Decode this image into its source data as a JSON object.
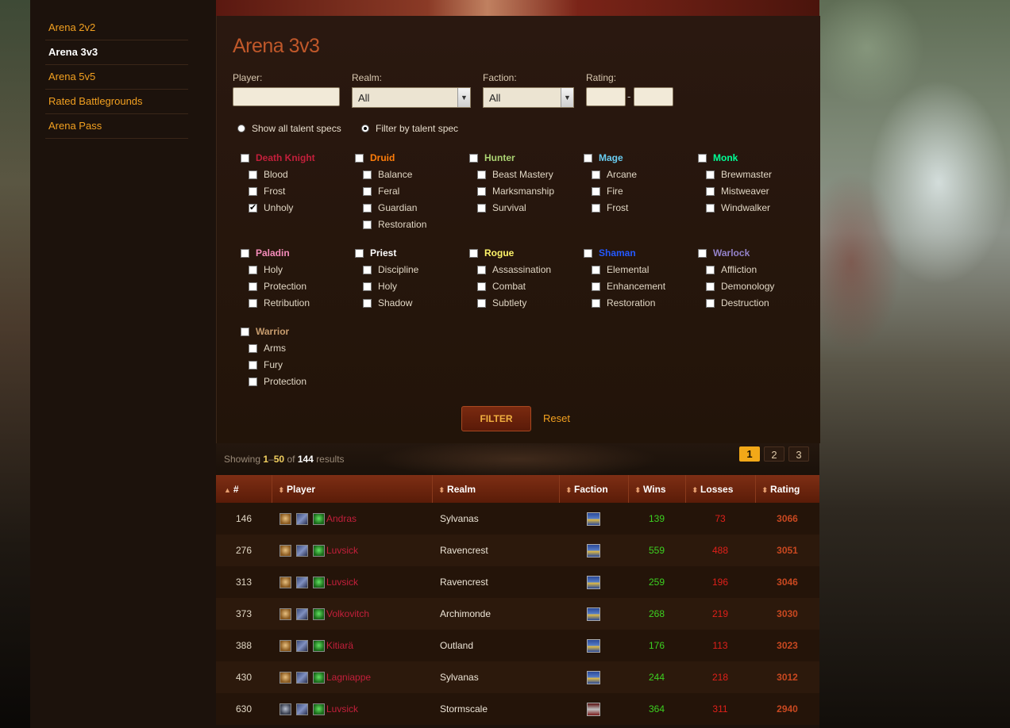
{
  "sidebar": {
    "items": [
      {
        "label": "Arena 2v2",
        "active": false
      },
      {
        "label": "Arena 3v3",
        "active": true
      },
      {
        "label": "Arena 5v5",
        "active": false
      },
      {
        "label": "Rated Battlegrounds",
        "active": false
      },
      {
        "label": "Arena Pass",
        "active": false
      }
    ]
  },
  "page": {
    "title": "Arena 3v3"
  },
  "filters": {
    "player_label": "Player:",
    "player_value": "",
    "realm_label": "Realm:",
    "realm_value": "All",
    "faction_label": "Faction:",
    "faction_value": "All",
    "rating_label": "Rating:",
    "rating_min": "",
    "rating_max": "",
    "rating_sep": "-",
    "radio_all": "Show all talent specs",
    "radio_filter": "Filter by talent spec",
    "radio_selected": "filter",
    "filter_button": "FILTER",
    "reset_link": "Reset"
  },
  "classes": [
    {
      "name": "Death Knight",
      "color": "#c41f3b",
      "specs": [
        {
          "name": "Blood",
          "checked": false
        },
        {
          "name": "Frost",
          "checked": false
        },
        {
          "name": "Unholy",
          "checked": true
        }
      ]
    },
    {
      "name": "Druid",
      "color": "#ff7d0a",
      "specs": [
        {
          "name": "Balance",
          "checked": false
        },
        {
          "name": "Feral",
          "checked": false
        },
        {
          "name": "Guardian",
          "checked": false
        },
        {
          "name": "Restoration",
          "checked": false
        }
      ]
    },
    {
      "name": "Hunter",
      "color": "#abd473",
      "specs": [
        {
          "name": "Beast Mastery",
          "checked": false
        },
        {
          "name": "Marksmanship",
          "checked": false
        },
        {
          "name": "Survival",
          "checked": false
        }
      ]
    },
    {
      "name": "Mage",
      "color": "#69ccf0",
      "specs": [
        {
          "name": "Arcane",
          "checked": false
        },
        {
          "name": "Fire",
          "checked": false
        },
        {
          "name": "Frost",
          "checked": false
        }
      ]
    },
    {
      "name": "Monk",
      "color": "#00ff96",
      "specs": [
        {
          "name": "Brewmaster",
          "checked": false
        },
        {
          "name": "Mistweaver",
          "checked": false
        },
        {
          "name": "Windwalker",
          "checked": false
        }
      ]
    },
    {
      "name": "Paladin",
      "color": "#f58cba",
      "specs": [
        {
          "name": "Holy",
          "checked": false
        },
        {
          "name": "Protection",
          "checked": false
        },
        {
          "name": "Retribution",
          "checked": false
        }
      ]
    },
    {
      "name": "Priest",
      "color": "#ffffff",
      "specs": [
        {
          "name": "Discipline",
          "checked": false
        },
        {
          "name": "Holy",
          "checked": false
        },
        {
          "name": "Shadow",
          "checked": false
        }
      ]
    },
    {
      "name": "Rogue",
      "color": "#fff569",
      "specs": [
        {
          "name": "Assassination",
          "checked": false
        },
        {
          "name": "Combat",
          "checked": false
        },
        {
          "name": "Subtlety",
          "checked": false
        }
      ]
    },
    {
      "name": "Shaman",
      "color": "#2459ff",
      "specs": [
        {
          "name": "Elemental",
          "checked": false
        },
        {
          "name": "Enhancement",
          "checked": false
        },
        {
          "name": "Restoration",
          "checked": false
        }
      ]
    },
    {
      "name": "Warlock",
      "color": "#9482c9",
      "specs": [
        {
          "name": "Affliction",
          "checked": false
        },
        {
          "name": "Demonology",
          "checked": false
        },
        {
          "name": "Destruction",
          "checked": false
        }
      ]
    },
    {
      "name": "Warrior",
      "color": "#c79c6e",
      "specs": [
        {
          "name": "Arms",
          "checked": false
        },
        {
          "name": "Fury",
          "checked": false
        },
        {
          "name": "Protection",
          "checked": false
        }
      ]
    }
  ],
  "results": {
    "showing_prefix": "Showing",
    "range_start": "1",
    "range_sep": "–",
    "range_end": "50",
    "of": "of",
    "total": "144",
    "suffix": "results",
    "pages": [
      "1",
      "2",
      "3"
    ],
    "current_page": "1"
  },
  "table": {
    "columns": [
      "#",
      "Player",
      "Realm",
      "Faction",
      "Wins",
      "Losses",
      "Rating"
    ],
    "rows": [
      {
        "rank": "146",
        "player": "Andras",
        "realm": "Sylvanas",
        "faction": "alliance",
        "race": "race",
        "wins": "139",
        "losses": "73",
        "rating": "3066"
      },
      {
        "rank": "276",
        "player": "Luvsick",
        "realm": "Ravencrest",
        "faction": "alliance",
        "race": "race",
        "wins": "559",
        "losses": "488",
        "rating": "3051"
      },
      {
        "rank": "313",
        "player": "Luvsick",
        "realm": "Ravencrest",
        "faction": "alliance",
        "race": "race",
        "wins": "259",
        "losses": "196",
        "rating": "3046"
      },
      {
        "rank": "373",
        "player": "Volkovitch",
        "realm": "Archimonde",
        "faction": "alliance",
        "race": "race",
        "wins": "268",
        "losses": "219",
        "rating": "3030"
      },
      {
        "rank": "388",
        "player": "Kitiarä",
        "realm": "Outland",
        "faction": "alliance",
        "race": "race",
        "wins": "176",
        "losses": "113",
        "rating": "3023"
      },
      {
        "rank": "430",
        "player": "Lagniappe",
        "realm": "Sylvanas",
        "faction": "alliance",
        "race": "race",
        "wins": "244",
        "losses": "218",
        "rating": "3012"
      },
      {
        "rank": "630",
        "player": "Luvsick",
        "realm": "Stormscale",
        "faction": "horde",
        "race": "race2",
        "wins": "364",
        "losses": "311",
        "rating": "2940"
      }
    ]
  }
}
